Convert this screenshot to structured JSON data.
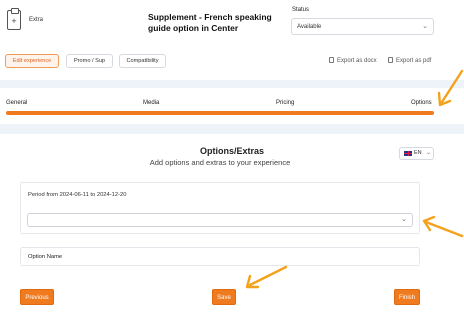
{
  "header": {
    "extra_label": "Extra",
    "extra_icon_glyph": "+",
    "title": "Supplement - French speaking guide option in Center",
    "status_label": "Status",
    "status_value": "Available"
  },
  "toolbar": {
    "tabs": [
      "Edit experience",
      "Promo / Sup",
      "Compatibility"
    ],
    "export_docx": "Export as docx",
    "export_pdf": "Export as pdf"
  },
  "steps": {
    "items": [
      "General",
      "Media",
      "Pricing",
      "Options"
    ],
    "progress_percent": 100
  },
  "section": {
    "title": "Options/Extras",
    "subtitle": "Add options and extras to your experience",
    "language": "EN"
  },
  "period": {
    "text": "Period from 2024-06-11 to 2024-12-20",
    "select_value": ""
  },
  "option_name_label": "Option Name",
  "buttons": {
    "previous": "Previous",
    "save": "Save",
    "finish": "Finish"
  },
  "colors": {
    "accent": "#f07a1e",
    "band": "#eef3f9",
    "arrow": "#f4a21c"
  },
  "icons": [
    "clipboard-plus-icon",
    "document-icon",
    "chevron-down-icon",
    "uk-flag-icon",
    "arrow-annotation"
  ]
}
